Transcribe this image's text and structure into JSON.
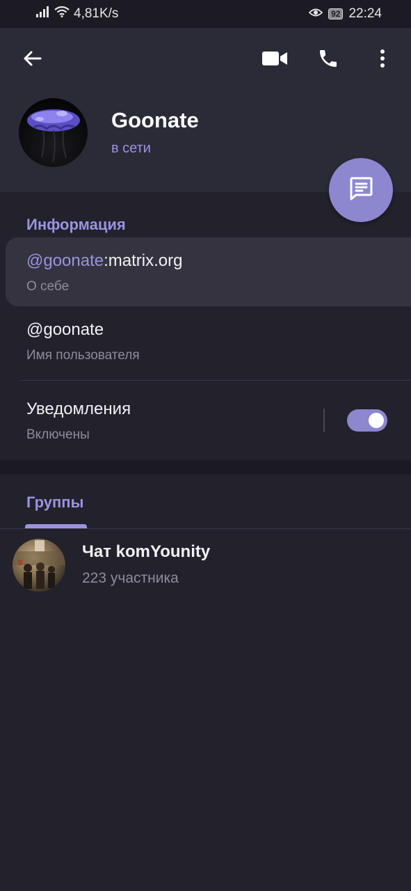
{
  "status_bar": {
    "speed": "4,81K/s",
    "battery": "92",
    "time": "22:24"
  },
  "header": {
    "back_icon": "arrow-left-icon",
    "video_icon": "video-camera-icon",
    "call_icon": "phone-icon",
    "menu_icon": "more-vertical-icon"
  },
  "profile": {
    "name": "Goonate",
    "status": "в сети"
  },
  "info": {
    "section_title": "Информация",
    "matrix_id_user": "@goonate",
    "matrix_id_server": ":matrix.org",
    "matrix_id_caption": "О себе",
    "username": "@goonate",
    "username_caption": "Имя пользователя",
    "notifications_label": "Уведомления",
    "notifications_state": "Включены",
    "notifications_enabled": true
  },
  "groups": {
    "tab_label": "Группы",
    "items": [
      {
        "name": "Чат komYounity",
        "members": "223 участника"
      }
    ]
  },
  "colors": {
    "accent": "#9b93e0",
    "fab": "#8c87cf",
    "background": "#22212c",
    "header": "#2b2a37"
  }
}
